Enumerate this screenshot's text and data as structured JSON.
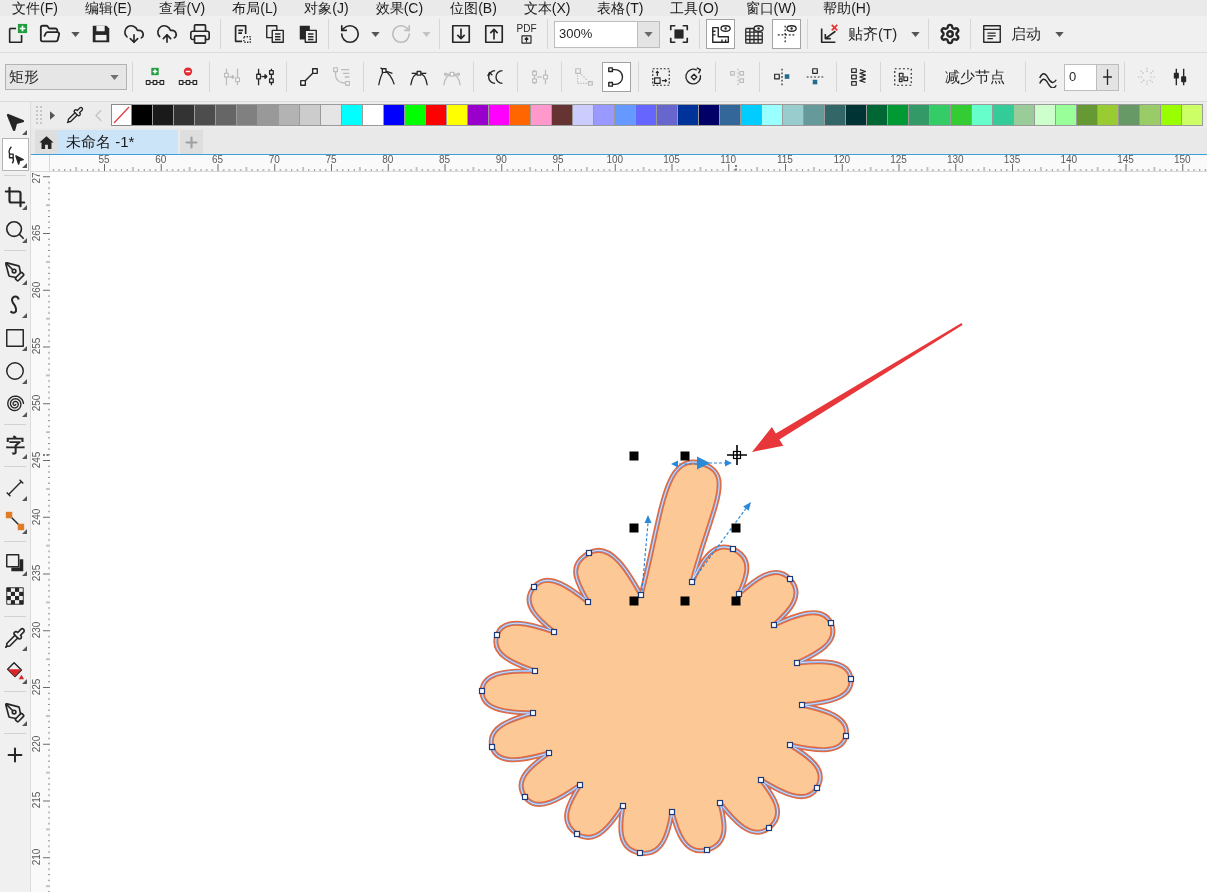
{
  "menu_bar": [
    "文件(F)",
    "编辑(E)",
    "查看(V)",
    "布局(L)",
    "对象(J)",
    "效果(C)",
    "位图(B)",
    "文本(X)",
    "表格(T)",
    "工具(O)",
    "窗口(W)",
    "帮助(H)"
  ],
  "standard_toolbar": {
    "groups": [
      [
        {
          "kind": "new",
          "dropdown": false,
          "disabled": false,
          "pressed": false
        },
        {
          "kind": "open",
          "dropdown": true,
          "disabled": false,
          "pressed": false
        },
        {
          "kind": "save",
          "dropdown": false,
          "disabled": false,
          "pressed": false
        },
        {
          "kind": "cloud-download",
          "dropdown": false,
          "disabled": false,
          "pressed": false
        },
        {
          "kind": "cloud-upload",
          "dropdown": false,
          "disabled": false,
          "pressed": false
        },
        {
          "kind": "print",
          "dropdown": false,
          "disabled": false,
          "pressed": false
        }
      ],
      [
        {
          "kind": "cut",
          "dropdown": false,
          "disabled": false,
          "pressed": false
        },
        {
          "kind": "copy",
          "dropdown": false,
          "disabled": false,
          "pressed": false
        },
        {
          "kind": "paste",
          "dropdown": false,
          "disabled": false,
          "pressed": false
        }
      ],
      [
        {
          "kind": "undo",
          "dropdown": true,
          "disabled": false,
          "pressed": false
        },
        {
          "kind": "redo",
          "dropdown": true,
          "disabled": true,
          "pressed": false
        }
      ],
      [
        {
          "kind": "import",
          "dropdown": false,
          "disabled": false,
          "pressed": false
        },
        {
          "kind": "export",
          "dropdown": false,
          "disabled": false,
          "pressed": false
        },
        {
          "kind": "pdf",
          "label": "PDF",
          "dropdown": false,
          "disabled": false,
          "pressed": false
        }
      ],
      [
        {
          "kind": "zoom",
          "value": "300%",
          "dropdown": true,
          "disabled": false,
          "pressed": false
        },
        {
          "kind": "full-screen",
          "dropdown": false,
          "disabled": false,
          "pressed": false
        }
      ],
      [
        {
          "kind": "rulers",
          "dropdown": false,
          "disabled": false,
          "pressed": true
        },
        {
          "kind": "grid",
          "dropdown": false,
          "disabled": false,
          "pressed": false
        },
        {
          "kind": "guides",
          "dropdown": false,
          "disabled": false,
          "pressed": true
        }
      ],
      [
        {
          "kind": "snap",
          "label": "贴齐(T)",
          "dropdown": true,
          "disabled": false,
          "pressed": false
        }
      ],
      [
        {
          "kind": "options",
          "dropdown": false,
          "disabled": false,
          "pressed": false
        }
      ],
      [
        {
          "kind": "launch",
          "label": "启动",
          "dropdown": true,
          "disabled": false,
          "pressed": false
        }
      ]
    ]
  },
  "property_bar": {
    "groups": [
      [
        {
          "kind": "shape-type",
          "value": "矩形",
          "dropdown": true,
          "disabled": false,
          "pressed": false
        }
      ],
      [
        {
          "kind": "add-node",
          "dropdown": false,
          "disabled": false,
          "pressed": false
        },
        {
          "kind": "delete-node",
          "dropdown": false,
          "disabled": false,
          "pressed": false
        }
      ],
      [
        {
          "kind": "join-nodes",
          "dropdown": false,
          "disabled": true,
          "pressed": false
        },
        {
          "kind": "break-curve",
          "dropdown": false,
          "disabled": false,
          "pressed": false
        }
      ],
      [
        {
          "kind": "to-line",
          "dropdown": false,
          "disabled": false,
          "pressed": false
        },
        {
          "kind": "to-curve",
          "dropdown": false,
          "disabled": true,
          "pressed": false
        }
      ],
      [
        {
          "kind": "cusp",
          "dropdown": false,
          "disabled": false,
          "pressed": false
        },
        {
          "kind": "smooth",
          "dropdown": false,
          "disabled": false,
          "pressed": false
        },
        {
          "kind": "symmetric",
          "dropdown": false,
          "disabled": true,
          "pressed": false
        }
      ],
      [
        {
          "kind": "reverse",
          "dropdown": false,
          "disabled": false,
          "pressed": false
        }
      ],
      [
        {
          "kind": "extract",
          "dropdown": false,
          "disabled": true,
          "pressed": false
        }
      ],
      [
        {
          "kind": "extend",
          "dropdown": false,
          "disabled": true,
          "pressed": false
        },
        {
          "kind": "close-curve",
          "dropdown": false,
          "disabled": false,
          "pressed": true
        }
      ],
      [
        {
          "kind": "stretch",
          "dropdown": false,
          "disabled": false,
          "pressed": false
        },
        {
          "kind": "rotate",
          "dropdown": false,
          "disabled": false,
          "pressed": false
        }
      ],
      [
        {
          "kind": "align",
          "dropdown": false,
          "disabled": true,
          "pressed": false
        }
      ],
      [
        {
          "kind": "reflect-horizontal",
          "dropdown": false,
          "disabled": false,
          "pressed": false
        },
        {
          "kind": "reflect-vertical",
          "dropdown": false,
          "disabled": false,
          "pressed": false
        }
      ],
      [
        {
          "kind": "elastic",
          "dropdown": false,
          "disabled": false,
          "pressed": false
        }
      ],
      [
        {
          "kind": "select-all",
          "dropdown": false,
          "disabled": false,
          "pressed": false
        }
      ],
      [
        {
          "kind": "reduce-nodes",
          "label": "减少节点",
          "dropdown": false,
          "disabled": false,
          "pressed": false
        }
      ],
      [
        {
          "kind": "smoothness",
          "dropdown": false,
          "disabled": false,
          "pressed": false
        },
        {
          "kind": "smoothness-field",
          "value": "0",
          "dropdown": false,
          "disabled": false,
          "pressed": false
        },
        {
          "kind": "slider",
          "dropdown": false,
          "disabled": false,
          "pressed": false
        }
      ],
      [
        {
          "kind": "burst",
          "dropdown": false,
          "disabled": true,
          "pressed": false
        },
        {
          "kind": "node-sliders",
          "dropdown": false,
          "disabled": false,
          "pressed": false
        }
      ]
    ]
  },
  "toolbox": {
    "groups": [
      [
        {
          "kind": "pick",
          "selected": false,
          "flyout": true
        },
        {
          "kind": "shape",
          "selected": true,
          "flyout": true
        }
      ],
      [
        {
          "kind": "crop",
          "selected": false,
          "flyout": true
        },
        {
          "kind": "zoom",
          "selected": false,
          "flyout": true
        }
      ],
      [
        {
          "kind": "freehand",
          "selected": false,
          "flyout": true
        },
        {
          "kind": "artistic",
          "selected": false,
          "flyout": true
        },
        {
          "kind": "rectangle",
          "selected": false,
          "flyout": true
        },
        {
          "kind": "ellipse",
          "selected": false,
          "flyout": true
        },
        {
          "kind": "spiral",
          "selected": false,
          "flyout": true
        }
      ],
      [
        {
          "kind": "text",
          "label": "字",
          "selected": false,
          "flyout": true
        }
      ],
      [
        {
          "kind": "dimension",
          "selected": false,
          "flyout": true
        },
        {
          "kind": "connector",
          "selected": false,
          "flyout": true
        }
      ],
      [
        {
          "kind": "shadow",
          "selected": false,
          "flyout": true
        },
        {
          "kind": "transparency",
          "selected": false,
          "flyout": false
        }
      ],
      [
        {
          "kind": "eyedropper",
          "selected": false,
          "flyout": true
        },
        {
          "kind": "fill",
          "selected": false,
          "flyout": true
        }
      ],
      [
        {
          "kind": "outline",
          "selected": false,
          "flyout": true
        }
      ],
      [
        {
          "kind": "add",
          "selected": false,
          "flyout": false
        }
      ]
    ]
  },
  "palette": {
    "swatches": [
      {
        "color": "#000000"
      },
      {
        "color": "#1a1a1a"
      },
      {
        "color": "#333333"
      },
      {
        "color": "#4d4d4d"
      },
      {
        "color": "#666666"
      },
      {
        "color": "#808080"
      },
      {
        "color": "#999999"
      },
      {
        "color": "#b3b3b3"
      },
      {
        "color": "#cccccc"
      },
      {
        "color": "#e5e5e5"
      },
      {
        "color": "#00ffff"
      },
      {
        "color": "#ffffff"
      },
      {
        "color": "#0000ff"
      },
      {
        "color": "#00ff00"
      },
      {
        "color": "#ff0000"
      },
      {
        "color": "#ffff00"
      },
      {
        "color": "#9900cc"
      },
      {
        "color": "#ff00ff"
      },
      {
        "color": "#ff6600"
      },
      {
        "color": "#ff99cc"
      },
      {
        "color": "#663333"
      },
      {
        "color": "#ccccff"
      },
      {
        "color": "#9999ff"
      },
      {
        "color": "#6699ff"
      },
      {
        "color": "#6666ff"
      },
      {
        "color": "#6666cc"
      },
      {
        "color": "#003399"
      },
      {
        "color": "#000066"
      },
      {
        "color": "#336699"
      },
      {
        "color": "#00ccff"
      },
      {
        "color": "#99ffff"
      },
      {
        "color": "#99cccc"
      },
      {
        "color": "#669999"
      },
      {
        "color": "#336666"
      },
      {
        "color": "#003333"
      },
      {
        "color": "#006633"
      },
      {
        "color": "#009933"
      },
      {
        "color": "#339966"
      },
      {
        "color": "#33cc66"
      },
      {
        "color": "#33cc33"
      },
      {
        "color": "#66ffcc"
      },
      {
        "color": "#33cc99"
      },
      {
        "color": "#99cc99"
      },
      {
        "color": "#ccffcc"
      },
      {
        "color": "#99ff99"
      },
      {
        "color": "#669933"
      },
      {
        "color": "#99cc33"
      },
      {
        "color": "#669966"
      },
      {
        "color": "#99cc66"
      },
      {
        "color": "#99ff00"
      },
      {
        "color": "#ccff66"
      }
    ]
  },
  "document_tabs": [
    {
      "title": "未命名 -1*",
      "selected": true
    }
  ],
  "horizontal_ruler": {
    "labels": [
      "55",
      "60",
      "65",
      "70",
      "75",
      "80",
      "85",
      "90",
      "95",
      "100",
      "105",
      "110",
      "115",
      "120",
      "125",
      "130",
      "135",
      "140",
      "145",
      "150"
    ]
  },
  "vertical_ruler": {
    "labels": [
      "27",
      "265",
      "260",
      "255",
      "250",
      "245",
      "240",
      "235",
      "230",
      "225",
      "220",
      "215",
      "210"
    ]
  }
}
